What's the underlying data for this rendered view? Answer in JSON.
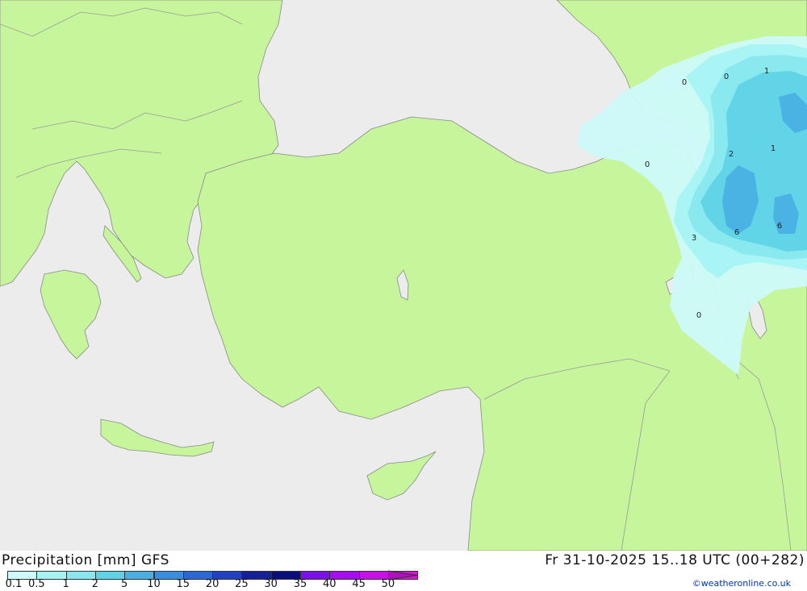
{
  "title": {
    "left": "Precipitation [mm] GFS",
    "right": "Fr 31-10-2025 15..18 UTC (00+282)"
  },
  "legend": {
    "ticks": [
      "0.1",
      "0.5",
      "1",
      "2",
      "5",
      "10",
      "15",
      "20",
      "25",
      "30",
      "35",
      "40",
      "45",
      "50"
    ],
    "colors": [
      "#cdfafa",
      "#a6f3f3",
      "#88e8ee",
      "#5fd3e6",
      "#4ab0e4",
      "#3a8ee0",
      "#2c67d6",
      "#2140c2",
      "#16209a",
      "#0a0d7e",
      "#7c10e8",
      "#a80cf0",
      "#c810e8",
      "#e010e0",
      "#b010c0"
    ]
  },
  "credit": "©weatheronline.co.uk",
  "map_labels": [
    "0",
    "0",
    "1",
    "1",
    "2",
    "0",
    "6",
    "6",
    "3",
    "0"
  ],
  "colors": {
    "sea": "#ececec",
    "land": "#c6f59c",
    "border": "#9a9a9a"
  }
}
